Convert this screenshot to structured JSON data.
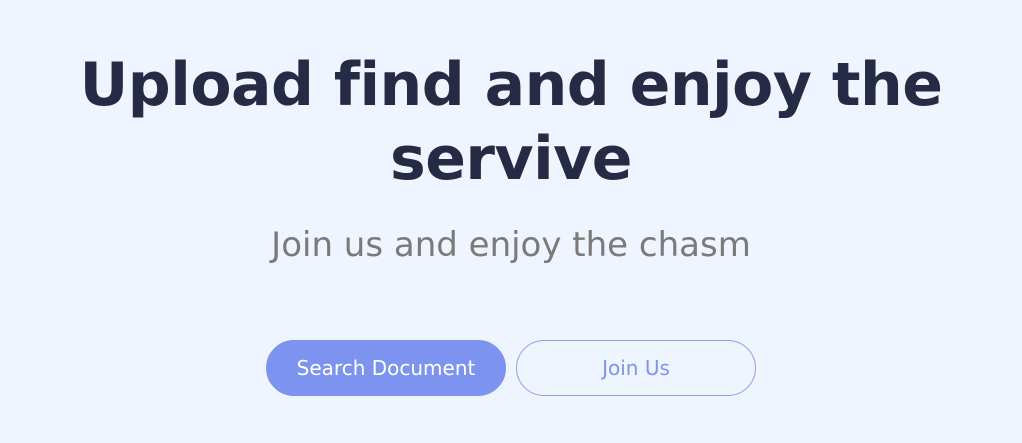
{
  "hero": {
    "title": "Upload find and enjoy the servive",
    "subtitle": "Join us and enjoy the chasm"
  },
  "actions": {
    "primary_label": "Search Document",
    "secondary_label": "Join Us"
  },
  "colors": {
    "background": "#eff5fe",
    "title": "#252a45",
    "subtitle": "#7a7a7a",
    "accent": "#7c94ef"
  }
}
